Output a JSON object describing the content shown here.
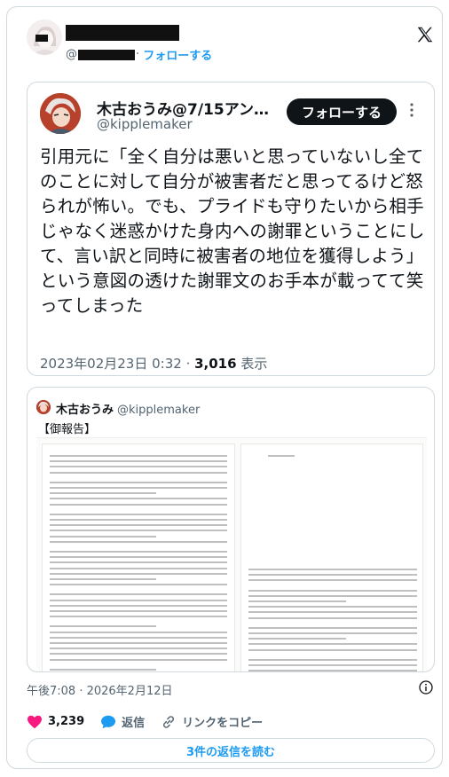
{
  "header": {
    "handle_prefix": "@",
    "follow_label": "フォローする"
  },
  "quoted_tweet": {
    "name": "木古おうみ@7/15アン…",
    "handle": "@kipplemaker",
    "follow_label": "フォローする",
    "more": "⋮",
    "text": "引用元に「全く自分は悪いと思っていないし全てのことに対して自分が被害者だと思ってるけど怒られが怖い。でも、プライドも守りたいから相手じゃなく迷惑かけた身内への謝罪ということにして、言い訳と同時に被害者の地位を獲得しよう」という意図の透けた謝罪文のお手本が載ってて笑ってしまった",
    "date": "2023年02月23日 0:32 · ",
    "view_count": "3,016",
    "view_label": " 表示"
  },
  "embed": {
    "name": "木古おうみ",
    "handle": "@kipplemaker",
    "text": "【御報告】"
  },
  "footer": {
    "timestamp": "午後7:08 · 2026年2月12日",
    "like_count": "3,239",
    "reply_label": "返信",
    "copy_link_label": "リンクをコピー",
    "read_replies_label": "3件の返信を読む"
  },
  "colors": {
    "accent": "#1d9bf0",
    "like": "#f91880",
    "text": "#0f1419",
    "muted": "#536471",
    "border": "#cfd9de"
  },
  "icons": [
    "x-logo-icon",
    "more-icon",
    "heart-icon",
    "reply-bubble-icon",
    "link-icon",
    "info-icon"
  ]
}
